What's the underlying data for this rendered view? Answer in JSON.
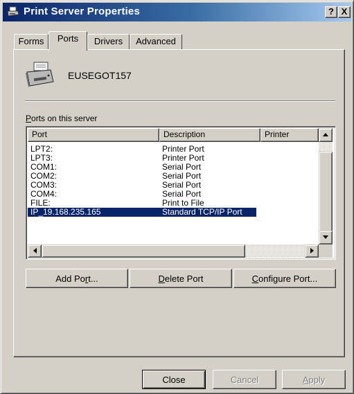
{
  "window": {
    "title": "Print Server Properties",
    "help_btn": "?",
    "close_btn": "X",
    "title_gradient": [
      "#0a246a",
      "#a6caf0"
    ]
  },
  "tabs": [
    {
      "label": "Forms",
      "active": false
    },
    {
      "label": "Ports",
      "active": true
    },
    {
      "label": "Drivers",
      "active": false
    },
    {
      "label": "Advanced",
      "active": false
    }
  ],
  "server": {
    "name": "EUSEGOT157",
    "icon": "printer-server-icon"
  },
  "ports_group": {
    "label_mnemonic": "P",
    "label_rest": "orts on this server"
  },
  "ports_list": {
    "columns": [
      "Port",
      "Description",
      "Printer"
    ],
    "rows": [
      {
        "port": "LPT2:",
        "description": "Printer Port",
        "printer": ""
      },
      {
        "port": "LPT3:",
        "description": "Printer Port",
        "printer": ""
      },
      {
        "port": "COM1:",
        "description": "Serial Port",
        "printer": ""
      },
      {
        "port": "COM2:",
        "description": "Serial Port",
        "printer": ""
      },
      {
        "port": "COM3:",
        "description": "Serial Port",
        "printer": ""
      },
      {
        "port": "COM4:",
        "description": "Serial Port",
        "printer": ""
      },
      {
        "port": "FILE:",
        "description": "Print to File",
        "printer": ""
      },
      {
        "port": "IP_19.168.235.165",
        "description": "Standard TCP/IP Port",
        "printer": ""
      }
    ],
    "selected_index": 7,
    "selection_color": "#0a246a"
  },
  "actions": {
    "add_port": {
      "pre": "Add Po",
      "mnemonic": "r",
      "post": "t..."
    },
    "delete_port": {
      "pre": "",
      "mnemonic": "D",
      "post": "elete Port"
    },
    "configure_port": {
      "pre": "",
      "mnemonic": "C",
      "post": "onfigure Port..."
    }
  },
  "footer": {
    "close": "Close",
    "cancel": "Cancel",
    "apply_pre": "",
    "apply_mnemonic": "A",
    "apply_post": "pply"
  },
  "colors": {
    "face": "#d4d0c8",
    "shadow": "#808080",
    "dark_shadow": "#404040",
    "highlight": "#ffffff"
  }
}
